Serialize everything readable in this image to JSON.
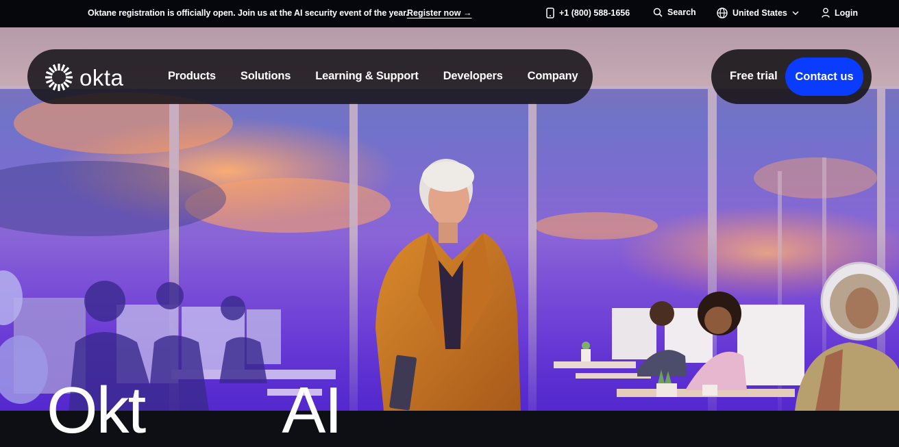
{
  "announcement": {
    "message": "Oktane registration is officially open. Join us at the AI security event of the year.",
    "link_label": "Register now →"
  },
  "utility": {
    "phone": "+1 (800) 588-1656",
    "search_label": "Search",
    "region_label": "United States",
    "login_label": "Login"
  },
  "nav": {
    "logo_text": "okta",
    "items": [
      {
        "label": "Products"
      },
      {
        "label": "Solutions"
      },
      {
        "label": "Learning & Support"
      },
      {
        "label": "Developers"
      },
      {
        "label": "Company"
      }
    ],
    "free_trial_label": "Free trial",
    "contact_label": "Contact us"
  },
  "hero": {
    "headline_part1": "Okt",
    "headline_part2": "AI"
  },
  "colors": {
    "topbar_bg": "#05070c",
    "nav_bg": "#18161a",
    "accent_blue": "#0a3cff",
    "text": "#ffffff"
  },
  "icons": [
    "phone-icon",
    "search-icon",
    "globe-icon",
    "chevron-down-icon",
    "user-icon",
    "okta-sunburst-logo"
  ]
}
